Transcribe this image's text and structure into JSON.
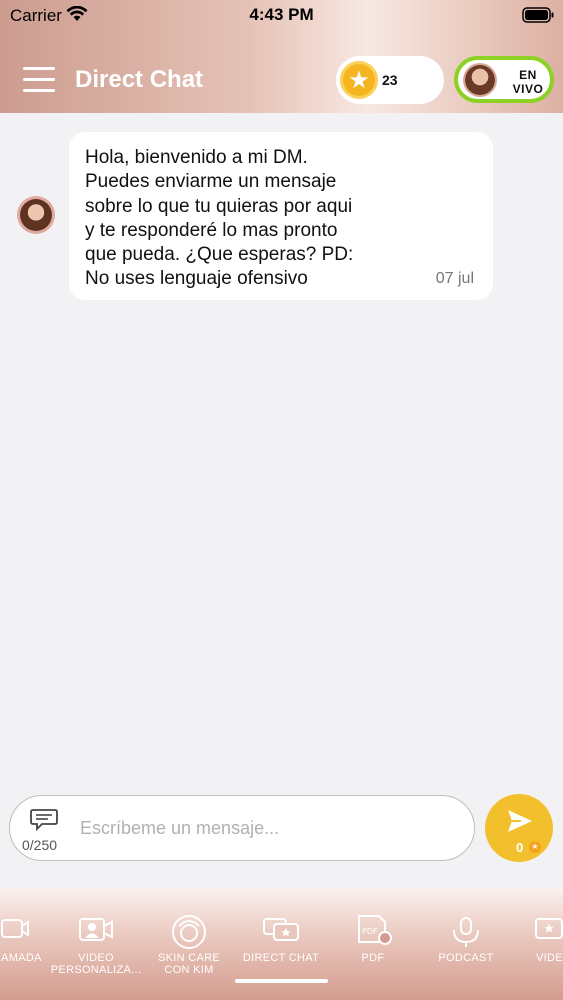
{
  "status_bar": {
    "carrier": "Carrier",
    "time": "4:43 PM"
  },
  "header": {
    "title": "Direct Chat",
    "coins": "23",
    "live_label_line1": "EN",
    "live_label_line2": "VIVO"
  },
  "chat": {
    "messages": [
      {
        "text": "Hola, bienvenido a mi DM.\nPuedes enviarme un mensaje\nsobre lo que tu quieras por aqui\ny te responderé lo mas pronto\nque pueda. ¿Que esperas? PD:\nNo uses lenguaje ofensivo",
        "date": "07 jul"
      }
    ]
  },
  "composer": {
    "char_count": "0/250",
    "placeholder": "Escríbeme un mensaje...",
    "send_cost": "0"
  },
  "tabbar": {
    "tabs": [
      {
        "label": "LLAMADA",
        "icon": "video-call-icon"
      },
      {
        "label": "VIDEO\nPERSONALIZA...",
        "icon": "personalized-video-icon"
      },
      {
        "label": "SKIN CARE\nCON KIM",
        "icon": "skin-care-icon"
      },
      {
        "label": "DIRECT CHAT",
        "icon": "direct-chat-icon",
        "active": true
      },
      {
        "label": "PDF",
        "icon": "pdf-icon"
      },
      {
        "label": "PODCAST",
        "icon": "podcast-icon"
      },
      {
        "label": "VIDE",
        "icon": "video-icon"
      }
    ]
  },
  "colors": {
    "accent_gold": "#f2c02d",
    "live_border": "#8dd127",
    "header_rose": "#cc9c8f"
  }
}
